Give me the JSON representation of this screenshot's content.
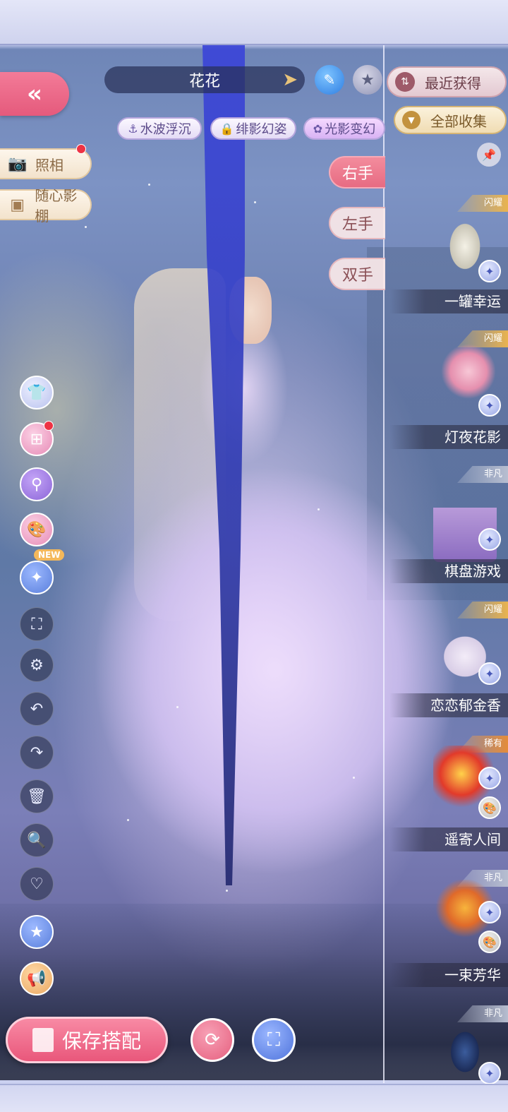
{
  "character": {
    "name": "花花"
  },
  "effects": [
    {
      "label": "水波浮沉",
      "icon": "anchor-icon"
    },
    {
      "label": "绯影幻姿",
      "icon": "lock-icon"
    },
    {
      "label": "光影变幻",
      "icon": "flower-icon"
    }
  ],
  "hands": [
    "右手",
    "左手",
    "双手"
  ],
  "left_features": {
    "photo": "照相",
    "studio": "随心影棚"
  },
  "new_tag": "NEW",
  "bottom": {
    "save_label": "保存搭配"
  },
  "panel": {
    "sort_label": "最近获得",
    "filter_label": "全部收集",
    "items": [
      {
        "name": "一罐幸运",
        "rarity": "闪耀",
        "rarity_color": "#e9b34f"
      },
      {
        "name": "灯夜花影",
        "rarity": "闪耀",
        "rarity_color": "#e9b34f"
      },
      {
        "name": "棋盘游戏",
        "rarity": "非凡",
        "rarity_color": "#b7bed0"
      },
      {
        "name": "恋恋郁金香",
        "rarity": "闪耀",
        "rarity_color": "#e9b34f"
      },
      {
        "name": "遥寄人间",
        "rarity": "稀有",
        "rarity_color": "#e48c3a"
      },
      {
        "name": "一束芳华",
        "rarity": "非凡",
        "rarity_color": "#b7bed0"
      },
      {
        "name": "",
        "rarity": "非凡",
        "rarity_color": "#b7bed0"
      }
    ]
  },
  "colors": {
    "accent_pink": "#e9577b",
    "panel_divider": "#f0f0ff",
    "streak_blue": "#3742c8"
  }
}
